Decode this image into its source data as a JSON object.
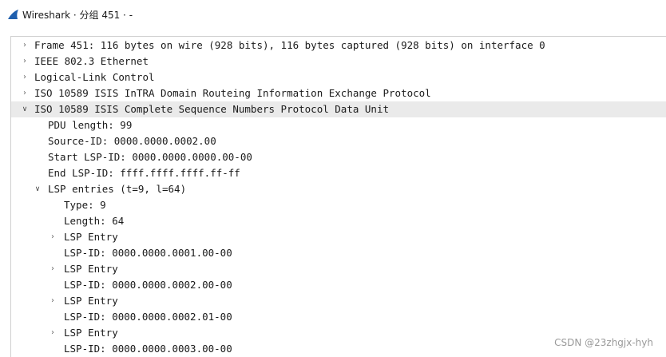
{
  "window": {
    "title": "Wireshark · 分组 451 · -",
    "logo_icon": "wireshark-fin-icon",
    "logo_color": "#1f5fae"
  },
  "tree": {
    "rows": [
      {
        "label": "Frame 451: 116 bytes on wire (928 bits), 116 bytes captured (928 bits) on interface 0",
        "level": 0,
        "toggle": "collapsed"
      },
      {
        "label": "IEEE 802.3 Ethernet",
        "level": 0,
        "toggle": "collapsed"
      },
      {
        "label": "Logical-Link Control",
        "level": 0,
        "toggle": "collapsed"
      },
      {
        "label": "ISO 10589 ISIS InTRA Domain Routeing Information Exchange Protocol",
        "level": 0,
        "toggle": "collapsed"
      },
      {
        "label": "ISO 10589 ISIS Complete Sequence Numbers Protocol Data Unit",
        "level": 0,
        "toggle": "expanded",
        "selected": true
      },
      {
        "label": "PDU length: 99",
        "level": 1,
        "toggle": "none"
      },
      {
        "label": "Source-ID: 0000.0000.0002.00",
        "level": 1,
        "toggle": "none"
      },
      {
        "label": "Start LSP-ID: 0000.0000.0000.00-00",
        "level": 1,
        "toggle": "none"
      },
      {
        "label": "End LSP-ID: ffff.ffff.ffff.ff-ff",
        "level": 1,
        "toggle": "none"
      },
      {
        "label": "LSP entries (t=9, l=64)",
        "level": 1,
        "toggle": "expanded"
      },
      {
        "label": "Type: 9",
        "level": 2,
        "toggle": "none"
      },
      {
        "label": "Length: 64",
        "level": 2,
        "toggle": "none"
      },
      {
        "label": "LSP Entry",
        "level": 2,
        "toggle": "collapsed"
      },
      {
        "label": "LSP-ID: 0000.0000.0001.00-00",
        "level": 2,
        "toggle": "none"
      },
      {
        "label": "LSP Entry",
        "level": 2,
        "toggle": "collapsed"
      },
      {
        "label": "LSP-ID: 0000.0000.0002.00-00",
        "level": 2,
        "toggle": "none"
      },
      {
        "label": "LSP Entry",
        "level": 2,
        "toggle": "collapsed"
      },
      {
        "label": "LSP-ID: 0000.0000.0002.01-00",
        "level": 2,
        "toggle": "none"
      },
      {
        "label": "LSP Entry",
        "level": 2,
        "toggle": "collapsed"
      },
      {
        "label": "LSP-ID: 0000.0000.0003.00-00",
        "level": 2,
        "toggle": "none"
      }
    ]
  },
  "watermark": {
    "text": "CSDN @23zhgjx-hyh"
  }
}
